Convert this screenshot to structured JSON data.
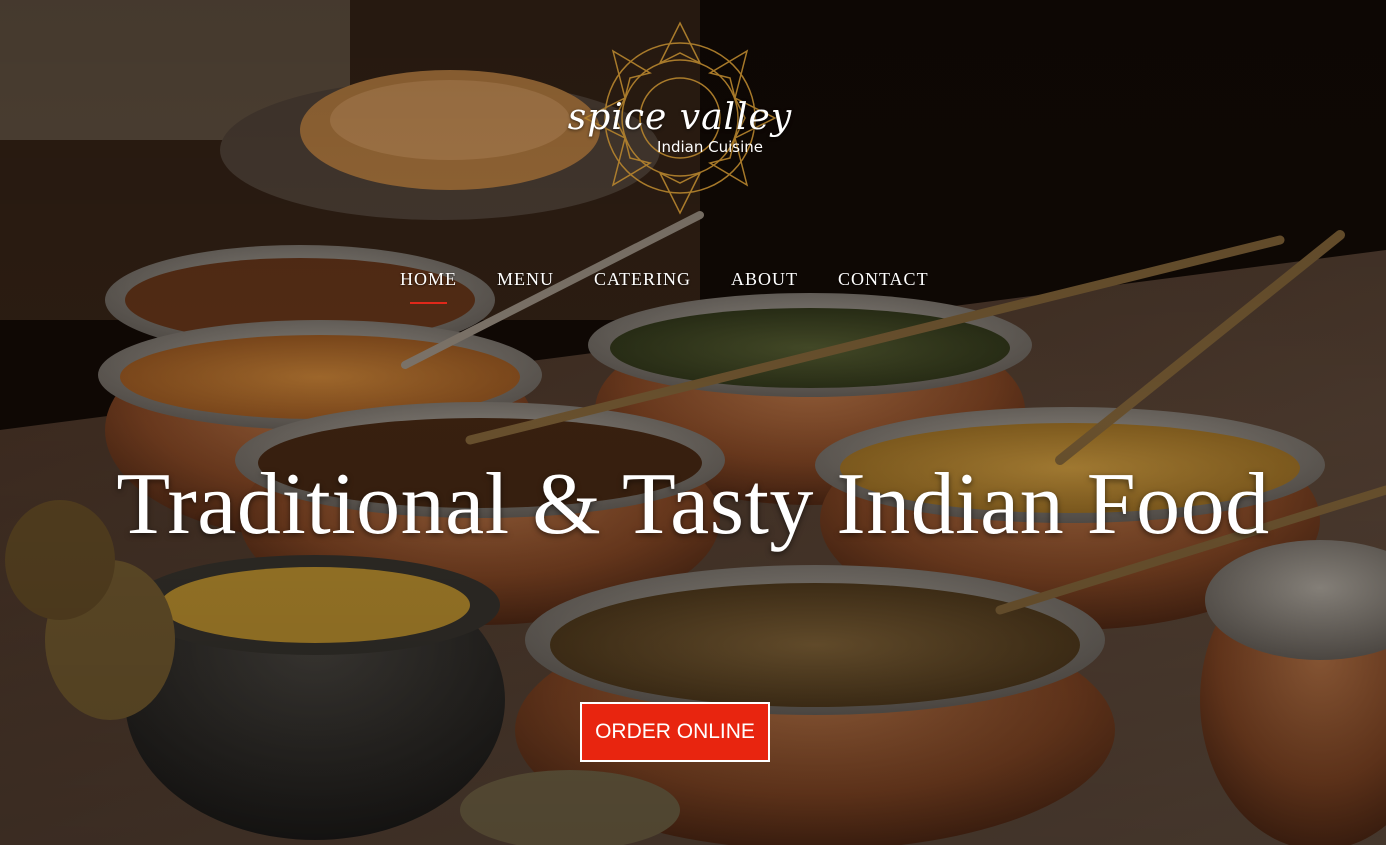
{
  "brand": {
    "name": "spice valley",
    "tagline": "Indian Cuisine"
  },
  "nav": {
    "items": [
      {
        "label": "HOME",
        "active": true
      },
      {
        "label": "MENU",
        "active": false
      },
      {
        "label": "CATERING",
        "active": false
      },
      {
        "label": "ABOUT",
        "active": false
      },
      {
        "label": "CONTACT",
        "active": false
      }
    ]
  },
  "hero": {
    "headline": "Traditional & Tasty Indian Food",
    "cta_label": "ORDER ONLINE",
    "background": "photo of copper pots filled with Indian dishes"
  },
  "colors": {
    "accent": "#e8250f",
    "text": "#ffffff",
    "logo_gold": "#b8862e"
  },
  "icons": {
    "logo_mandala": "mandala-icon"
  }
}
